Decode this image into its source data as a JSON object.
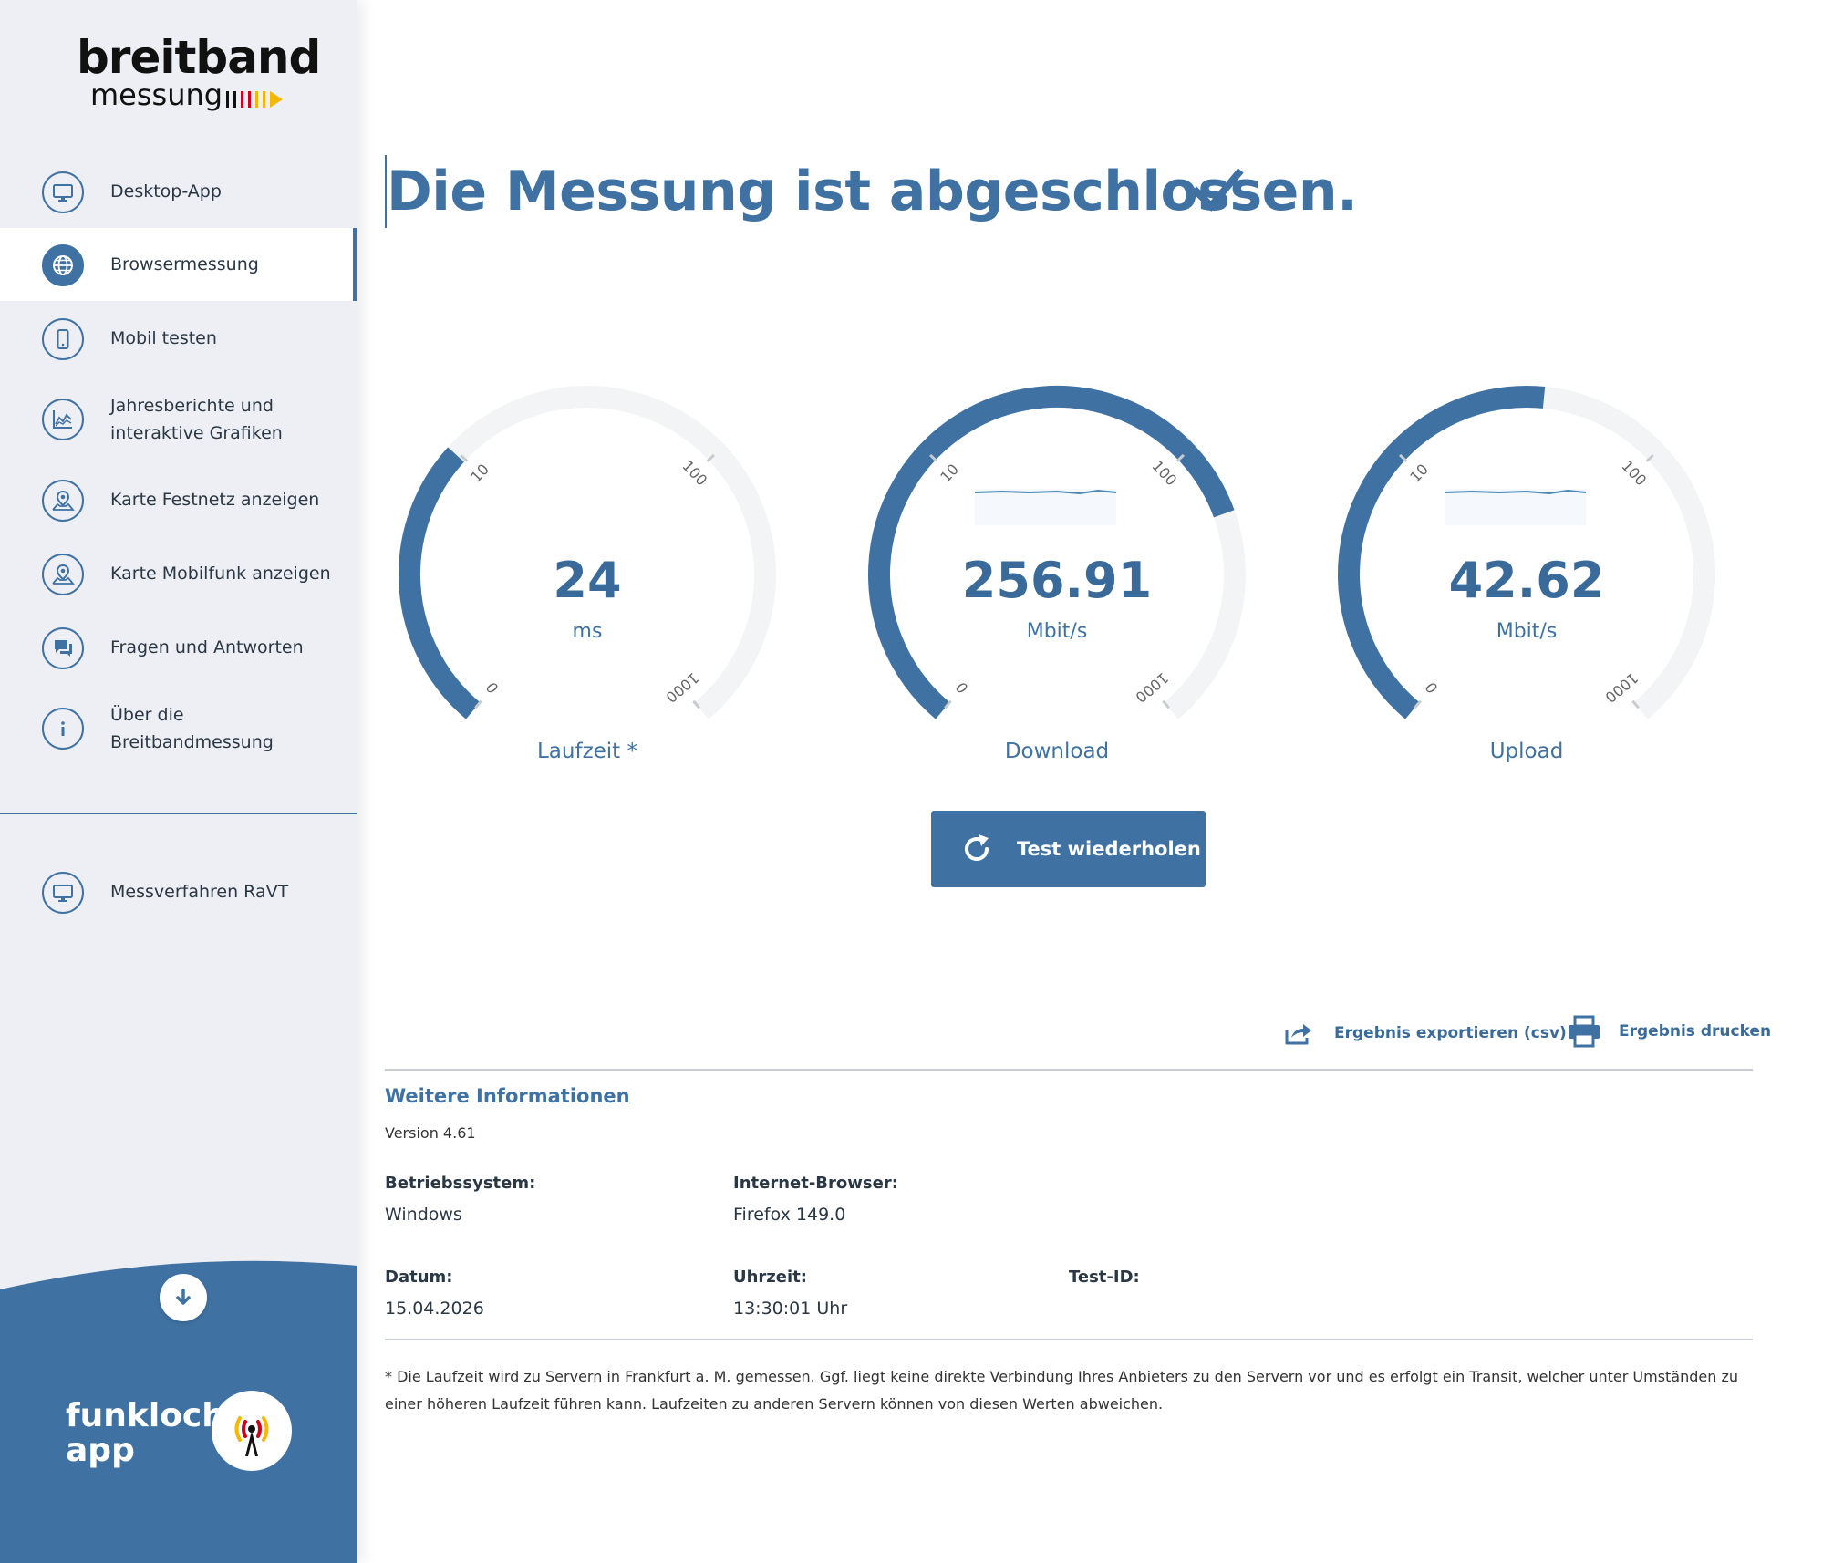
{
  "sidebar": {
    "logo": {
      "line1": "breitband",
      "line2": "messung"
    },
    "items": [
      {
        "label": "Desktop-App",
        "icon": "monitor-icon"
      },
      {
        "label": "Browsermessung",
        "icon": "globe-icon",
        "active": true
      },
      {
        "label": "Mobil testen",
        "icon": "smartphone-icon"
      },
      {
        "label": "Jahresberichte und\ninteraktive Grafiken",
        "icon": "chart-icon"
      },
      {
        "label": "Karte Festnetz anzeigen",
        "icon": "map-pin-icon"
      },
      {
        "label": "Karte Mobilfunk anzeigen",
        "icon": "map-pin-icon"
      },
      {
        "label": "Fragen und Antworten",
        "icon": "chat-icon"
      },
      {
        "label": "Über die\nBreitbandmessung",
        "icon": "info-icon"
      }
    ],
    "secondary": [
      {
        "label": "Messverfahren RaVT",
        "icon": "monitor-icon"
      }
    ],
    "funkloch": {
      "line1": "funkloch-",
      "line2": "app"
    },
    "colors": {
      "accent": "#3f72a3",
      "background": "#eeeff4"
    }
  },
  "main": {
    "title": "Die Messung ist abgeschlossen.",
    "gauges": [
      {
        "value": "24",
        "unit": "ms",
        "label": "Laufzeit *",
        "ticks": [
          "0",
          "10",
          "100",
          "1000"
        ],
        "fill_fraction": 0.33,
        "sparkline": false
      },
      {
        "value": "256.91",
        "unit": "Mbit/s",
        "label": "Download",
        "ticks": [
          "0",
          "10",
          "100",
          "1000"
        ],
        "fill_fraction": 0.75,
        "sparkline": true
      },
      {
        "value": "42.62",
        "unit": "Mbit/s",
        "label": "Upload",
        "ticks": [
          "0",
          "10",
          "100",
          "1000"
        ],
        "fill_fraction": 0.52,
        "sparkline": true
      }
    ],
    "retest_label": "Test wiederholen",
    "export_label": "Ergebnis exportieren (csv)",
    "print_label": "Ergebnis drucken",
    "info": {
      "title": "Weitere Informationen",
      "version": "Version 4.61",
      "os_label": "Betriebssystem:",
      "os_value": "Windows",
      "browser_label": "Internet-Browser:",
      "browser_value": "Firefox 149.0",
      "date_label": "Datum:",
      "date_value": "15.04.2026",
      "time_label": "Uhrzeit:",
      "time_value": "13:30:01 Uhr",
      "testid_label": "Test-ID:",
      "testid_value": ""
    },
    "footnote": "* Die Laufzeit wird zu Servern in Frankfurt a. M. gemessen. Ggf. liegt keine direkte Verbindung Ihres Anbieters zu den Servern vor und es erfolgt ein Transit, welcher unter Umständen zu einer höheren Laufzeit führen kann. Laufzeiten zu anderen Servern können von diesen Werten abweichen."
  }
}
